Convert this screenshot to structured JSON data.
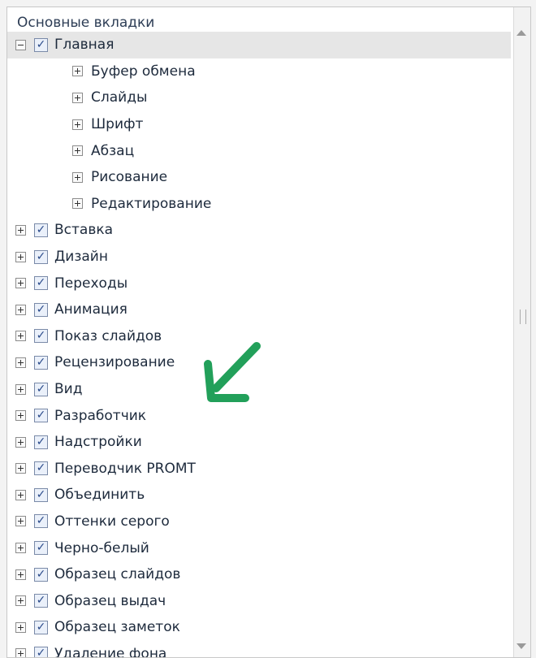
{
  "header": {
    "title": "Основные вкладки"
  },
  "tree": {
    "main": {
      "label": "Главная",
      "groups": [
        "Буфер обмена",
        "Слайды",
        "Шрифт",
        "Абзац",
        "Рисование",
        "Редактирование"
      ]
    },
    "tabs": [
      "Вставка",
      "Дизайн",
      "Переходы",
      "Анимация",
      "Показ слайдов",
      "Рецензирование",
      "Вид",
      "Разработчик",
      "Надстройки",
      "Переводчик PROMT",
      "Объединить",
      "Оттенки серого",
      "Черно-белый",
      "Образец слайдов",
      "Образец выдач",
      "Образец заметок",
      "Удаление фона"
    ]
  },
  "colors": {
    "arrow": "#22a05a",
    "selected_row": "#e6e6e6"
  },
  "icons": {
    "expander": "plus-minus-box-icon",
    "check": "checkmark-icon",
    "annotation": "green-arrow-icon"
  }
}
